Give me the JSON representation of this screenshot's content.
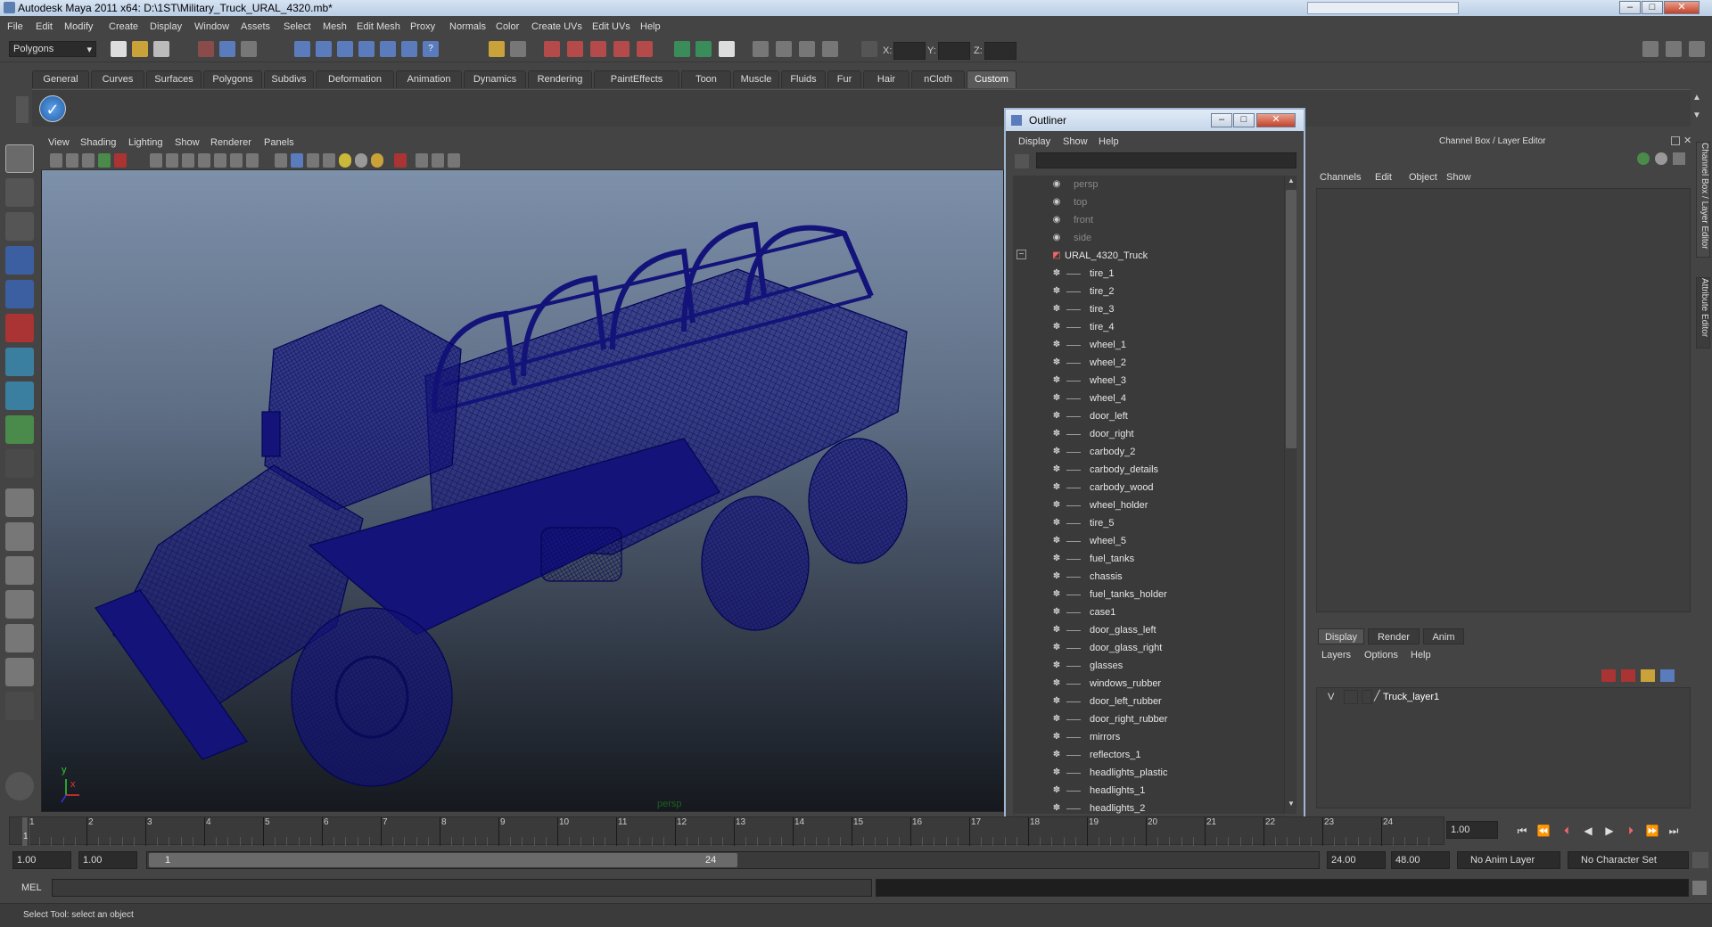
{
  "window": {
    "title": "Autodesk Maya 2011 x64: D:\\1ST\\Military_Truck_URAL_4320.mb*",
    "search_placeholder": ""
  },
  "menubar": [
    "File",
    "Edit",
    "Modify",
    "Create",
    "Display",
    "Window",
    "Assets",
    "Select",
    "Mesh",
    "Edit Mesh",
    "Proxy",
    "Normals",
    "Color",
    "Create UVs",
    "Edit UVs",
    "Help"
  ],
  "statusline": {
    "mode": "Polygons",
    "coords": {
      "x_label": "X:",
      "y_label": "Y:",
      "z_label": "Z:"
    }
  },
  "shelf": {
    "tabs": [
      "General",
      "Curves",
      "Surfaces",
      "Polygons",
      "Subdivs",
      "Deformation",
      "Animation",
      "Dynamics",
      "Rendering",
      "PaintEffects",
      "Toon",
      "Muscle",
      "Fluids",
      "Fur",
      "Hair",
      "nCloth",
      "Custom"
    ],
    "active_tab": "Custom"
  },
  "viewport": {
    "menu": [
      "View",
      "Shading",
      "Lighting",
      "Show",
      "Renderer",
      "Panels"
    ],
    "camera_label": "persp",
    "axis_y": "y",
    "axis_x": "x",
    "wire_color": "#13137a"
  },
  "outliner": {
    "title": "Outliner",
    "menu": [
      "Display",
      "Show",
      "Help"
    ],
    "cameras": [
      "persp",
      "top",
      "front",
      "side"
    ],
    "root": "URAL_4320_Truck",
    "children": [
      "tire_1",
      "tire_2",
      "tire_3",
      "tire_4",
      "wheel_1",
      "wheel_2",
      "wheel_3",
      "wheel_4",
      "door_left",
      "door_right",
      "carbody_2",
      "carbody_details",
      "carbody_wood",
      "wheel_holder",
      "tire_5",
      "wheel_5",
      "fuel_tanks",
      "chassis",
      "fuel_tanks_holder",
      "case1",
      "door_glass_left",
      "door_glass_right",
      "glasses",
      "windows_rubber",
      "door_left_rubber",
      "door_right_rubber",
      "mirrors",
      "reflectors_1",
      "headlights_plastic",
      "headlights_1",
      "headlights_2"
    ]
  },
  "channelbox": {
    "title": "Channel Box / Layer Editor",
    "menu": [
      "Channels",
      "Edit",
      "Object",
      "Show"
    ],
    "layer_tabs": [
      "Display",
      "Render",
      "Anim"
    ],
    "active_layer_tab": "Display",
    "layer_menu": [
      "Layers",
      "Options",
      "Help"
    ],
    "layer": {
      "visibility": "V",
      "name": "Truck_layer1"
    },
    "side_tabs": [
      "Channel Box / Layer Editor",
      "Attribute Editor"
    ]
  },
  "timeline": {
    "ticks": [
      "1",
      "2",
      "3",
      "4",
      "5",
      "6",
      "7",
      "8",
      "9",
      "10",
      "11",
      "12",
      "13",
      "14",
      "15",
      "16",
      "17",
      "18",
      "19",
      "20",
      "21",
      "22",
      "23",
      "24"
    ],
    "current_frame": "1",
    "current_time_field": "1.00"
  },
  "range": {
    "start": "1.00",
    "playback_start": "1.00",
    "slider_start": "1",
    "slider_end": "24",
    "playback_end": "24.00",
    "end": "48.00",
    "anim_layer": "No Anim Layer",
    "character_set": "No Character Set"
  },
  "cmdline": {
    "label": "MEL"
  },
  "helpline": {
    "text": "Select Tool: select an object"
  }
}
